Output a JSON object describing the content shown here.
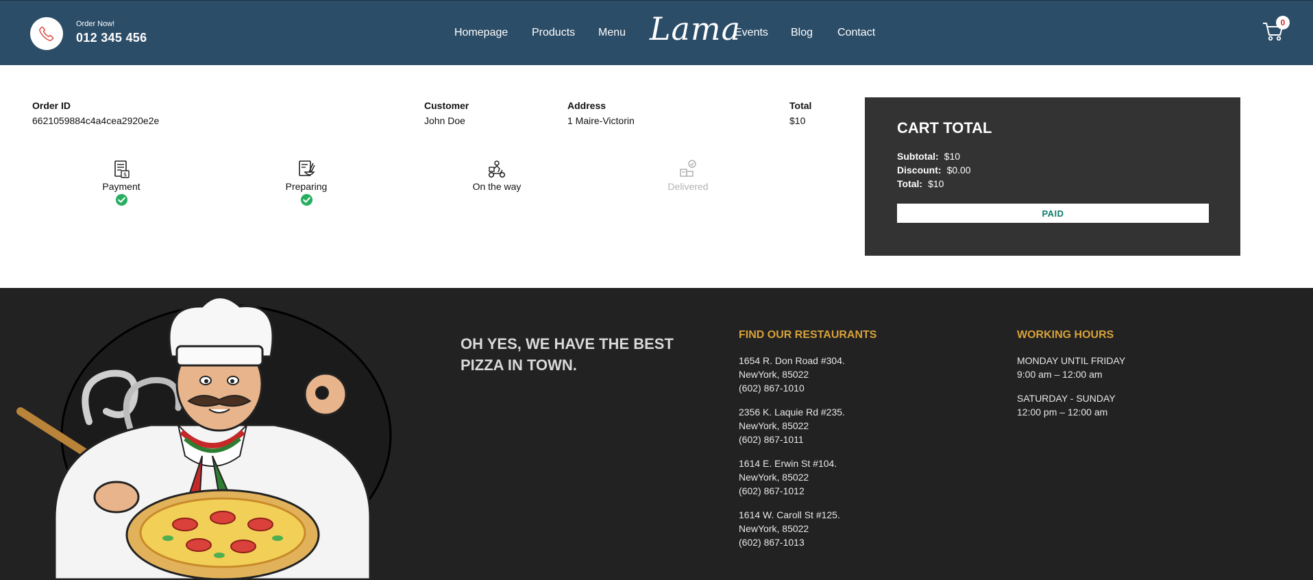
{
  "header": {
    "order_now": "Order Now!",
    "phone": "012 345 456",
    "nav": [
      "Homepage",
      "Products",
      "Menu",
      "Events",
      "Blog",
      "Contact"
    ],
    "logo": "Lama",
    "cart_count": "0",
    "colors": {
      "bar": "#2c4d68",
      "badge_text": "#d02b2b"
    }
  },
  "order": {
    "headers": {
      "order_id": "Order ID",
      "customer": "Customer",
      "address": "Address",
      "total": "Total"
    },
    "values": {
      "order_id": "6621059884c4a4cea2920e2e",
      "customer": "John Doe",
      "address": "1 Maire-Victorin",
      "total": "$10"
    },
    "statuses": [
      {
        "label": "Payment",
        "icon": "receipt-icon",
        "done": true
      },
      {
        "label": "Preparing",
        "icon": "chef-bowl-icon",
        "done": true
      },
      {
        "label": "On the way",
        "icon": "delivery-bike-icon",
        "done": false
      },
      {
        "label": "Delivered",
        "icon": "delivered-icon",
        "done": false
      }
    ]
  },
  "cart_total": {
    "title": "CART TOTAL",
    "subtotal_label": "Subtotal:",
    "subtotal": "$10",
    "discount_label": "Discount:",
    "discount": "$0.00",
    "total_label": "Total:",
    "total": "$10",
    "button": "PAID"
  },
  "footer": {
    "slogan": "OH YES, WE HAVE THE BEST PIZZA IN TOWN.",
    "restaurants_title": "FIND OUR RESTAURANTS",
    "restaurants": [
      {
        "street": "1654 R. Don Road #304.",
        "city": "NewYork, 85022",
        "phone": "(602) 867-1010"
      },
      {
        "street": "2356 K. Laquie Rd #235.",
        "city": "NewYork, 85022",
        "phone": "(602) 867-1011"
      },
      {
        "street": "1614 E. Erwin St #104.",
        "city": "NewYork, 85022",
        "phone": "(602) 867-1012"
      },
      {
        "street": "1614 W. Caroll St #125.",
        "city": "NewYork, 85022",
        "phone": "(602) 867-1013"
      }
    ],
    "hours_title": "WORKING HOURS",
    "hours": [
      {
        "days": "MONDAY UNTIL FRIDAY",
        "time": "9:00 am – 12:00 am"
      },
      {
        "days": "SATURDAY - SUNDAY",
        "time": "12:00 pm – 12:00 am"
      }
    ],
    "accent": "#d8a23a"
  }
}
